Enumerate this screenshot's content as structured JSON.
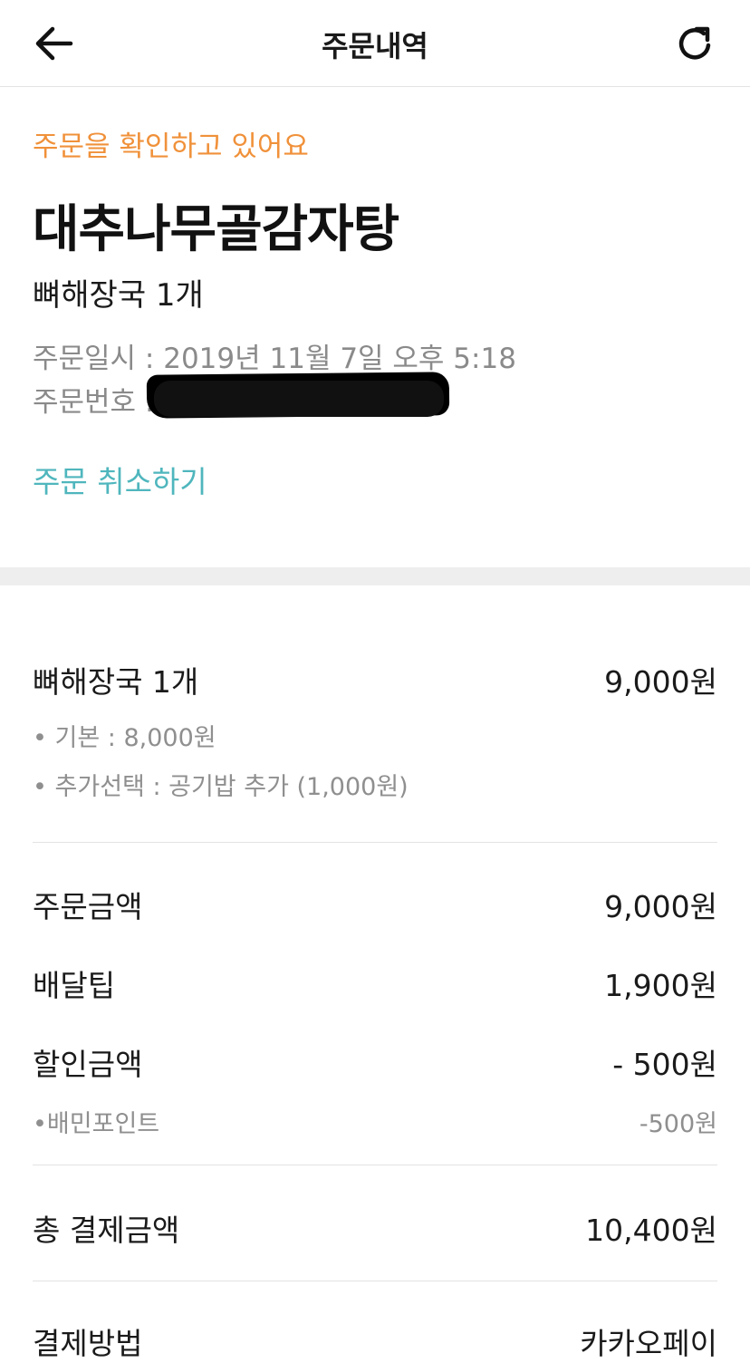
{
  "header": {
    "title": "주문내역",
    "back_icon": "arrow-left-icon",
    "refresh_icon": "refresh-icon"
  },
  "order": {
    "status": "주문을 확인하고 있어요",
    "store_name": "대추나무골감자탕",
    "menu_summary": "뼈해장국 1개",
    "date_line": "주문일시 : 2019년 11월 7일 오후 5:18",
    "order_number_label": "주문번호 :",
    "cancel_label": "주문 취소하기"
  },
  "item": {
    "name": "뼈해장국 1개",
    "price": "9,000원",
    "options": [
      "• 기본 : 8,000원",
      "• 추가선택 : 공기밥 추가 (1,000원)"
    ]
  },
  "summary": {
    "order_amount_label": "주문금액",
    "order_amount": "9,000원",
    "delivery_tip_label": "배달팁",
    "delivery_tip": "1,900원",
    "discount_label": "할인금액",
    "discount": "- 500원",
    "point_label": "•배민포인트",
    "point": "-500원",
    "total_label": "총 결제금액",
    "total": "10,400원",
    "payment_label": "결제방법",
    "payment": "카카오페이"
  },
  "colors": {
    "status": "#f0913a",
    "cancel": "#4fb6bd",
    "section_gap": "#eeeeee"
  }
}
